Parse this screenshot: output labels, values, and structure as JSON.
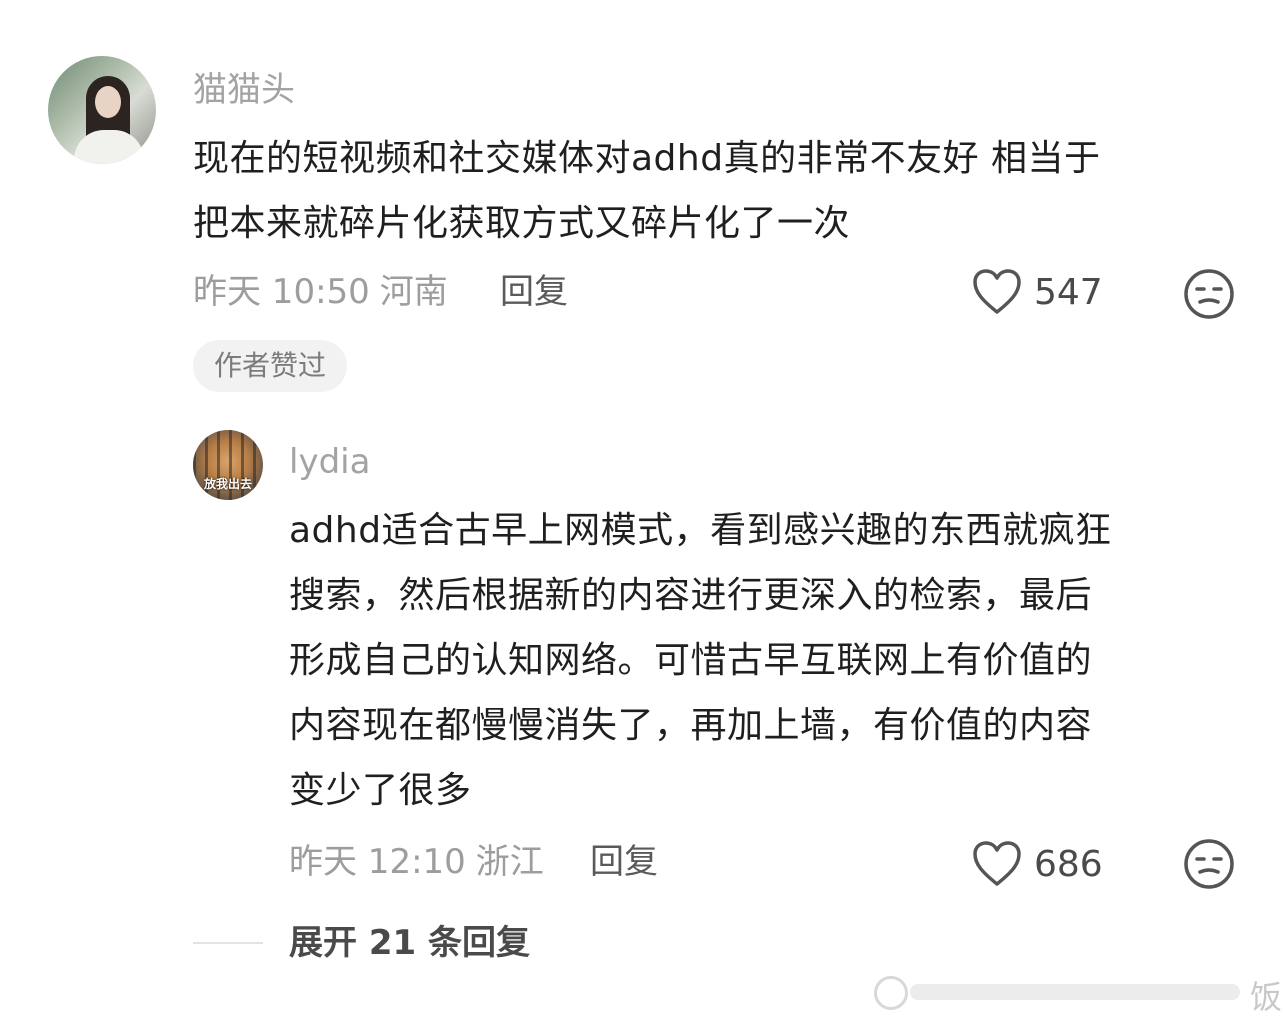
{
  "comment": {
    "username": "猫猫头",
    "lines": [
      "现在的短视频和社交媒体对adhd真的非常不友好 相当于",
      "把本来就碎片化获取方式又碎片化了一次"
    ],
    "time": "昨天 10:50",
    "location": "河南",
    "reply_label": "回复",
    "likes": "547",
    "author_tag": "作者赞过"
  },
  "reply": {
    "username": "lydia",
    "avatar_caption": "放我出去",
    "lines": [
      "adhd适合古早上网模式，看到感兴趣的东西就疯狂",
      "搜索，然后根据新的内容进行更深入的检索，最后",
      "形成自己的认知网络。可惜古早互联网上有价值的",
      "内容现在都慢慢消失了，再加上墙，有价值的内容",
      "变少了很多"
    ],
    "time": "昨天 12:10",
    "location": "浙江",
    "reply_label": "回复",
    "likes": "686"
  },
  "expand_label": "展开 21 条回复",
  "icons": {
    "like": "heart-outline-icon",
    "dislike": "meh-face-icon"
  }
}
